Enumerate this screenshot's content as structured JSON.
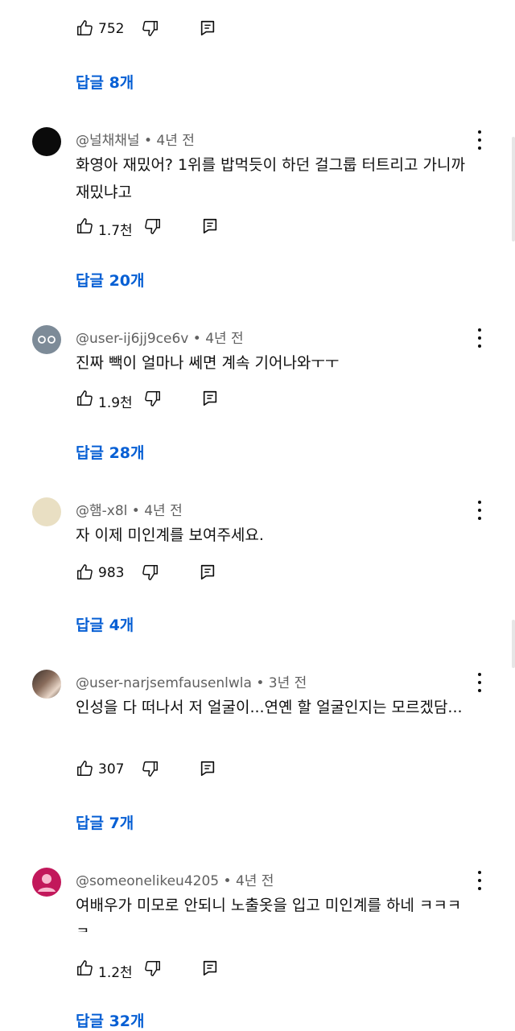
{
  "top": {
    "like_count": "752",
    "replies": "답글 8개"
  },
  "comments": [
    {
      "author": "@널채채널",
      "time": "4년 전",
      "text": "화영아 재밌어?  1위를 밥먹듯이 하던 걸그룹 터트리고 가니까 재밌냐고",
      "likes": "1.7천",
      "replies": "답글 20개",
      "avatar": "black-circle"
    },
    {
      "author": "@user-ij6jj9ce6v",
      "time": "4년 전",
      "text": "진짜 빽이 얼마나 쎄면 계속 기어나와ㅜㅜ",
      "likes": "1.9천",
      "replies": "답글 28개",
      "avatar": "gray-face"
    },
    {
      "author": "@햄-x8l",
      "time": "4년 전",
      "text": "자 이제 미인계를 보여주세요.",
      "likes": "983",
      "replies": "답글 4개",
      "avatar": "beige-circle"
    },
    {
      "author": "@user-narjsemfausenlwla",
      "time": "3년 전",
      "text": "인성을 다 떠나서 저 얼굴이...연옌 할 얼굴인지는 모르겠담...",
      "likes": "307",
      "replies": "답글 7개",
      "avatar": "photo"
    },
    {
      "author": "@someonelikeu4205",
      "time": "4년 전",
      "text": "여배우가 미모로 안되니 노출옷을 입고 미인계를 하네 ㅋㅋㅋㅋ",
      "likes": "1.2천",
      "replies": "답글 32개",
      "avatar": "pink-person"
    }
  ],
  "separator": "•",
  "colors": {
    "link": "#065fd4",
    "meta": "#606060",
    "text": "#0f0f0f"
  },
  "icons": [
    "thumbs-up-icon",
    "thumbs-down-icon",
    "reply-comment-icon",
    "more-vert-icon"
  ]
}
